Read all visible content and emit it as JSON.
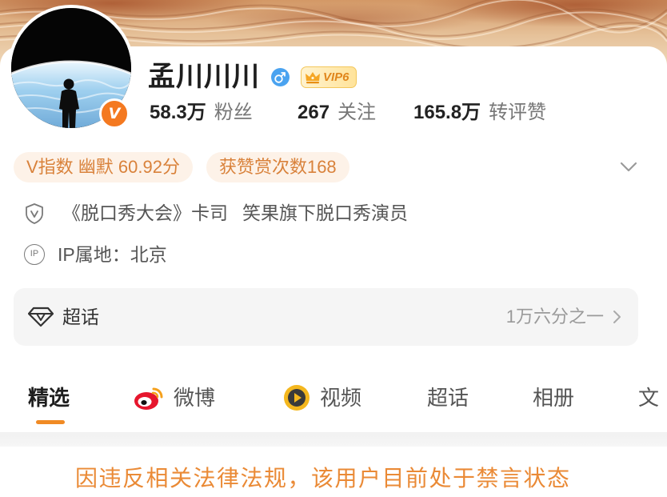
{
  "profile": {
    "verified_badge": "V",
    "name": "孟川川川",
    "gender_icon": "male-icon",
    "vip_label": "VIP6",
    "stats": [
      {
        "value": "58.3万",
        "label": "粉丝"
      },
      {
        "value": "267",
        "label": "关注"
      },
      {
        "value": "165.8万",
        "label": "转评赞"
      }
    ],
    "tags": [
      {
        "text": "V指数 幽默 60.92分"
      },
      {
        "text": "获赞赏次数168"
      }
    ],
    "expand_icon": "chevron-down-icon",
    "bio": {
      "icon": "shield-v-icon",
      "role": "《脱口秀大会》卡司",
      "company": "笑果旗下脱口秀演员"
    },
    "ip": {
      "icon_text": "IP",
      "text": "IP属地：北京"
    }
  },
  "supertopic": {
    "icon": "diamond-icon",
    "label": "超话",
    "rank": "1万六分之一",
    "arrow": "chevron-right-icon"
  },
  "tabs": [
    {
      "label": "精选",
      "active": true
    },
    {
      "label": "微博",
      "icon": "weibo-logo-icon"
    },
    {
      "label": "视频",
      "icon": "video-icon"
    },
    {
      "label": "超话"
    },
    {
      "label": "相册"
    },
    {
      "label": "文"
    }
  ],
  "notice": "因违反相关法律法规，该用户目前处于禁言状态",
  "colors": {
    "accent_orange": "#f08a24",
    "tag_text": "#d9823b",
    "tag_bg": "#fdf2e8",
    "notice_text": "#ea8a36",
    "verified_orange": "#f47920",
    "male_blue": "#4aa3f0",
    "vip_text": "#e0861c"
  }
}
